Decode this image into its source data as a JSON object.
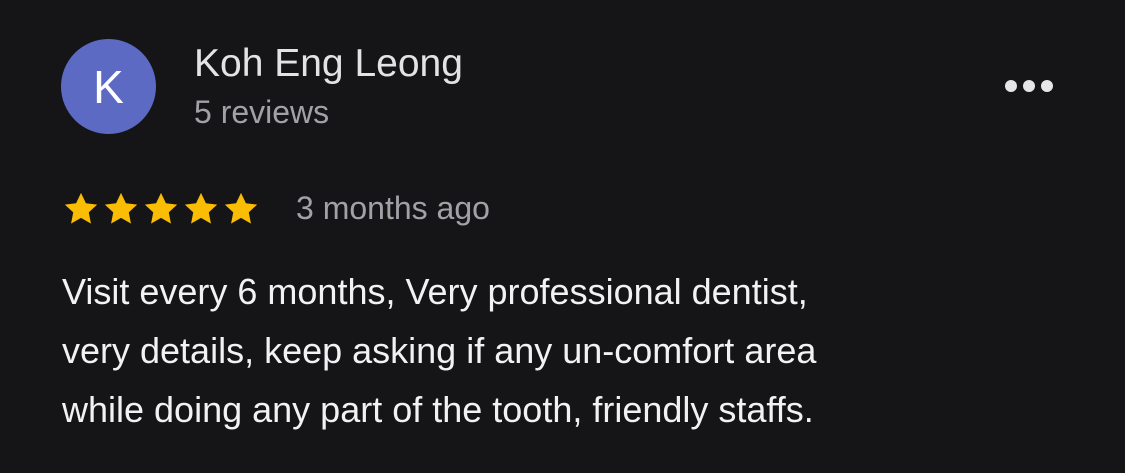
{
  "review": {
    "avatar_letter": "K",
    "avatar_color": "#5c6ac4",
    "author_name": "Koh Eng Leong",
    "review_count": "5 reviews",
    "more_icon": "ellipsis-horizontal-icon",
    "rating": 5,
    "max_rating": 5,
    "star_color": "#fbbc04",
    "date": "3 months ago",
    "text_lines": [
      "Visit every 6 months, Very professional dentist,",
      "very details, keep asking if any un-comfort area",
      "while doing any part of the tooth, friendly staffs."
    ]
  }
}
